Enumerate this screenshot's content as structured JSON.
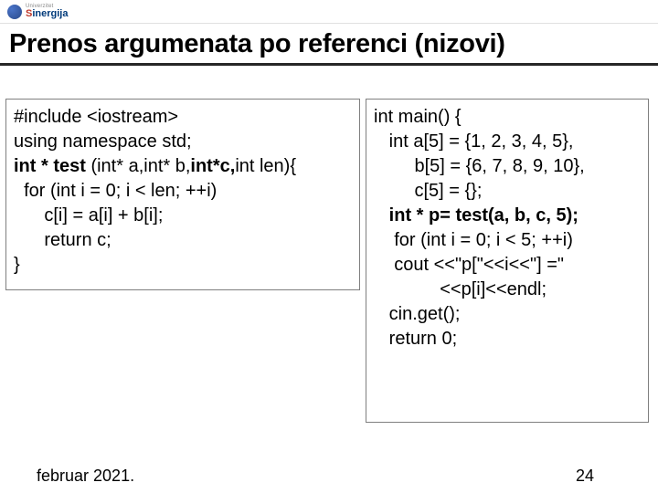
{
  "logo": {
    "univ": "Univerzitet",
    "name_s": "S",
    "name_rest": "inergija"
  },
  "title": "Prenos argumenata po referenci (nizovi)",
  "left": {
    "l1a": "#include <iostream>",
    "l2a": "using namespace std;",
    "l3a": "int * test ",
    "l3b": "(int* a,int* b,",
    "l3c": "int*c,",
    "l3d": "int len){",
    "l4": "  for (int i = 0; i < len; ++i)",
    "l5": "      c[i] = a[i] + b[i];",
    "l6": "      return c;",
    "l7": "}"
  },
  "right": {
    "l1": "int main() {",
    "l2": "   int a[5] = {1, 2, 3, 4, 5},",
    "l3": "        b[5] = {6, 7, 8, 9, 10},",
    "l4": "        c[5] = {};",
    "l5a": "   ",
    "l5b": "int * p= test(a, b, c, 5);",
    "l6": "    for (int i = 0; i < 5; ++i)",
    "l7": "    cout <<\"p[\"<<i<<\"] =\"",
    "l8": "             <<p[i]<<endl;",
    "l9": "   cin.get();",
    "l10": "   return 0;"
  },
  "footer": {
    "date": "februar 2021.",
    "page": "24"
  }
}
